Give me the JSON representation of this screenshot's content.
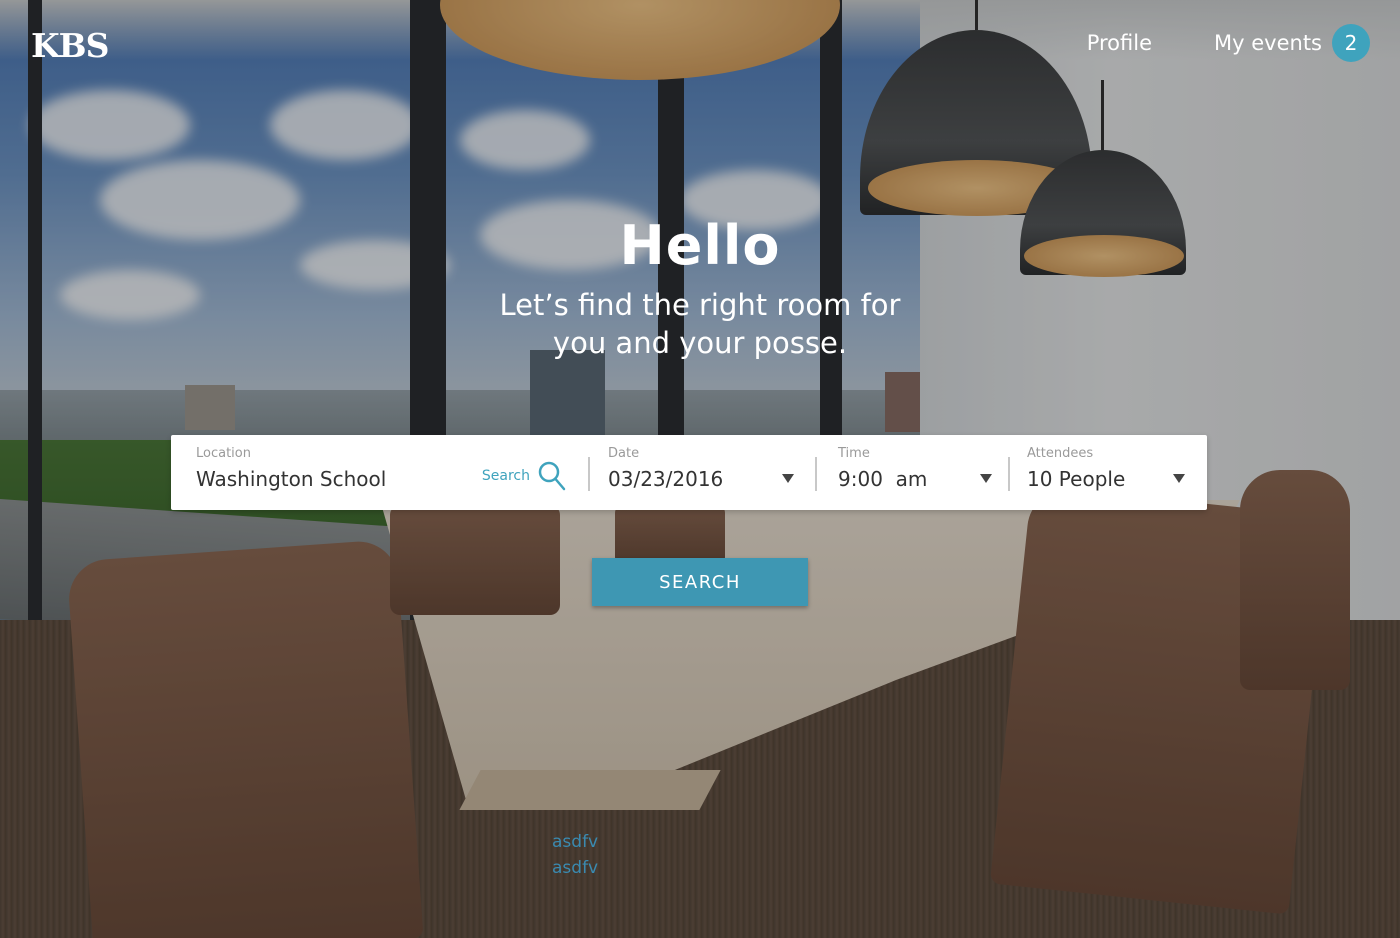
{
  "header": {
    "logo": "KBS",
    "nav": {
      "profile_label": "Profile",
      "events_label": "My events",
      "events_count": "2"
    }
  },
  "hero": {
    "title": "Hello",
    "subtitle_line1": "Let’s find the right room for",
    "subtitle_line2": "you and your posse."
  },
  "search_form": {
    "location": {
      "label": "Location",
      "value": "Washington School",
      "search_label": "Search"
    },
    "date": {
      "label": "Date",
      "value": "03/23/2016"
    },
    "time": {
      "label": "Time",
      "value": "9:00  am"
    },
    "attendees": {
      "label": "Attendees",
      "value": "10 People"
    },
    "submit_label": "SEARCH"
  },
  "debug_text": [
    "asdfv",
    "asdfv"
  ],
  "colors": {
    "accent": "#3fa3bd",
    "button": "#3e97b3",
    "debug_text": "#3a8ab0"
  },
  "icons": {
    "location_search": "magnifier-icon",
    "dropdown": "caret-down-icon"
  }
}
